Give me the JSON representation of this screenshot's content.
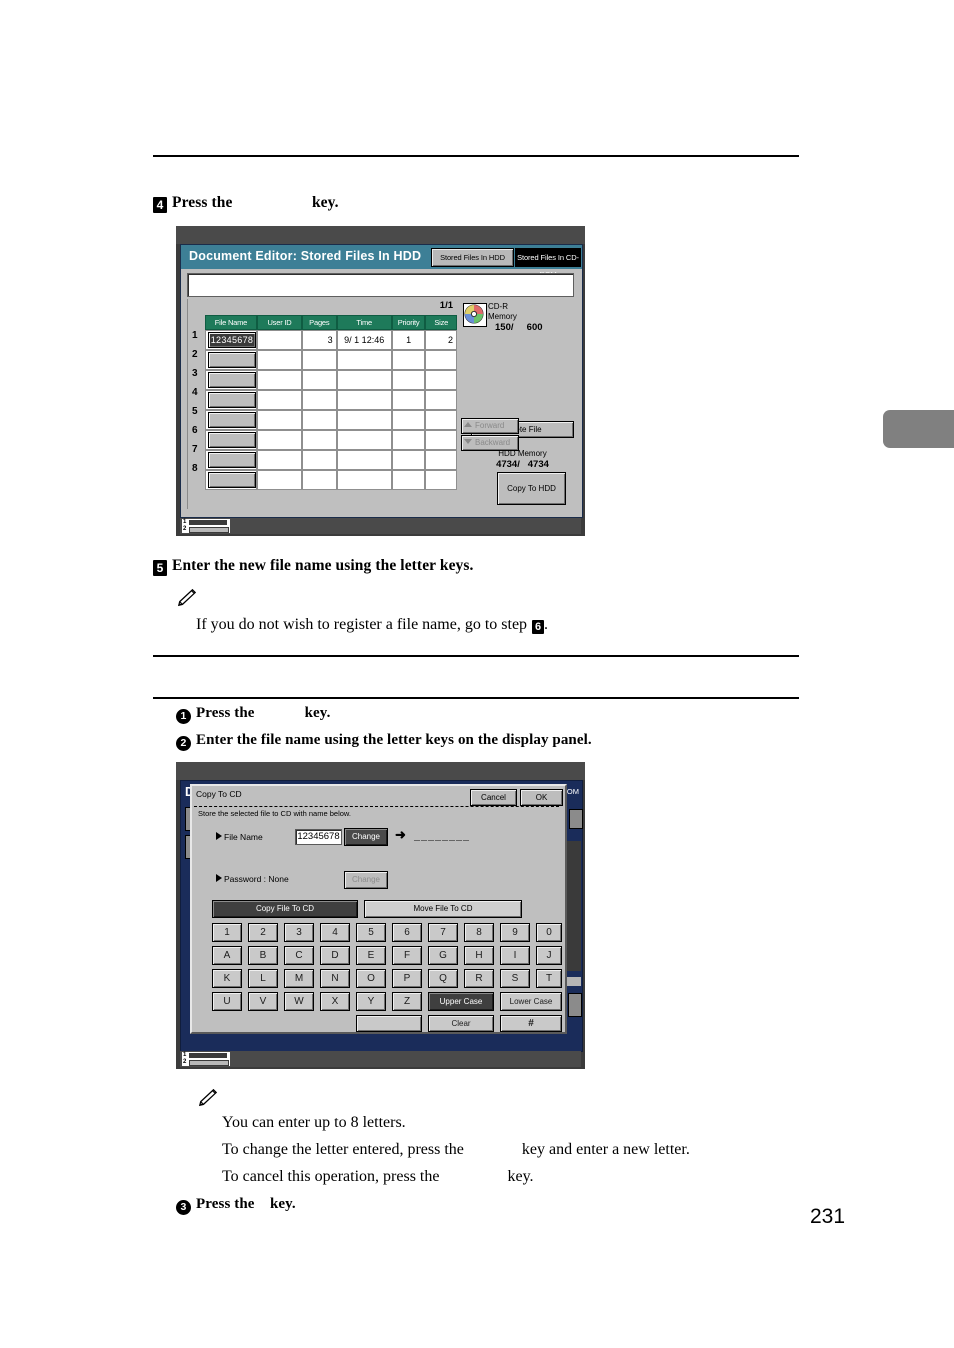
{
  "page": {
    "number": "231"
  },
  "steps": {
    "step4": {
      "num": "4",
      "pre": "Press the",
      "gap": "                    ",
      "post": "key."
    },
    "step5": {
      "num": "5",
      "text": "Enter the new file name using the letter keys."
    },
    "note5": {
      "pre": "If you do not wish to register a file name, go to step ",
      "ref": "6",
      "post": "."
    },
    "sub1": {
      "num": "1",
      "pre": "Press the",
      "gap": "             ",
      "post": "key."
    },
    "sub2": {
      "num": "2",
      "text": "Enter the file name using the letter keys on the display panel."
    },
    "sub3": {
      "num": "3",
      "pre": "Press the",
      "gap": "    ",
      "post": "key."
    }
  },
  "notes_bottom": {
    "line1": "You can enter up to 8 letters.",
    "line2a": "To change the letter entered, press the",
    "line2b": "key and enter a new letter.",
    "line3a": "To cancel this operation, press the",
    "line3b": "key."
  },
  "panel_hdd": {
    "title": "Document Editor: Stored Files In HDD",
    "tab_hdd": "Stored Files In HDD",
    "tab_cdrom": "Stored Files In CD-ROM",
    "page_indicator": "1/1",
    "columns": [
      "File Name",
      "User ID",
      "Pages",
      "Time",
      "Priority",
      "Size"
    ],
    "rows": [
      {
        "index": "1",
        "file_name": "12345678",
        "selected": true,
        "user_id": "",
        "pages": "3",
        "time": "9/ 1 12:46",
        "priority": "1",
        "size": "2"
      },
      {
        "index": "2",
        "file_name": "",
        "selected": false,
        "user_id": "",
        "pages": "",
        "time": "",
        "priority": "",
        "size": ""
      },
      {
        "index": "3",
        "file_name": "",
        "selected": false,
        "user_id": "",
        "pages": "",
        "time": "",
        "priority": "",
        "size": ""
      },
      {
        "index": "4",
        "file_name": "",
        "selected": false,
        "user_id": "",
        "pages": "",
        "time": "",
        "priority": "",
        "size": ""
      },
      {
        "index": "5",
        "file_name": "",
        "selected": false,
        "user_id": "",
        "pages": "",
        "time": "",
        "priority": "",
        "size": ""
      },
      {
        "index": "6",
        "file_name": "",
        "selected": false,
        "user_id": "",
        "pages": "",
        "time": "",
        "priority": "",
        "size": ""
      },
      {
        "index": "7",
        "file_name": "",
        "selected": false,
        "user_id": "",
        "pages": "",
        "time": "",
        "priority": "",
        "size": ""
      },
      {
        "index": "8",
        "file_name": "",
        "selected": false,
        "user_id": "",
        "pages": "",
        "time": "",
        "priority": "",
        "size": ""
      }
    ],
    "cd_label_line1": "CD-R",
    "cd_label_line2": "Memory",
    "cd_memory": "150/     600",
    "delete_file": "Delete File",
    "forward": "Forward",
    "backward": "Backward",
    "hdd_memory_label": "HDD Memory",
    "hdd_memory_value": "4734/   4734",
    "copy_to_hdd": "Copy To HDD",
    "tray_rows": [
      "1",
      "2"
    ],
    "colors": {
      "title_bar": "#3d7f96",
      "header": "#1e7a5a",
      "panel": "#bfbfbf"
    }
  },
  "panel_cd": {
    "under_title": "D",
    "under_title_right": "OM",
    "dialog_title": "Copy To CD",
    "cancel": "Cancel",
    "ok": "OK",
    "subtitle": "Store the selected file to CD with name below.",
    "file_name_label": "File Name",
    "file_name_value": "12345678",
    "file_name_change": "Change",
    "arrow": "➜",
    "dashes": "________",
    "password_label": "Password : None",
    "password_change": "Change",
    "copy_file_to_cd": "Copy File To CD",
    "move_file_to_cd": "Move File To CD",
    "keys_digits": [
      "1",
      "2",
      "3",
      "4",
      "5",
      "6",
      "7",
      "8",
      "9",
      "0"
    ],
    "keys_row_a": [
      "A",
      "B",
      "C",
      "D",
      "E",
      "F",
      "G",
      "H",
      "I",
      "J"
    ],
    "keys_row_k": [
      "K",
      "L",
      "M",
      "N",
      "O",
      "P",
      "Q",
      "R",
      "S",
      "T"
    ],
    "keys_row_u": [
      "U",
      "V",
      "W",
      "X",
      "Y",
      "Z"
    ],
    "upper_case": "Upper Case",
    "lower_case": "Lower Case",
    "space": "",
    "clear": "Clear",
    "hash": "#",
    "tray_rows": [
      "1",
      "2"
    ]
  }
}
